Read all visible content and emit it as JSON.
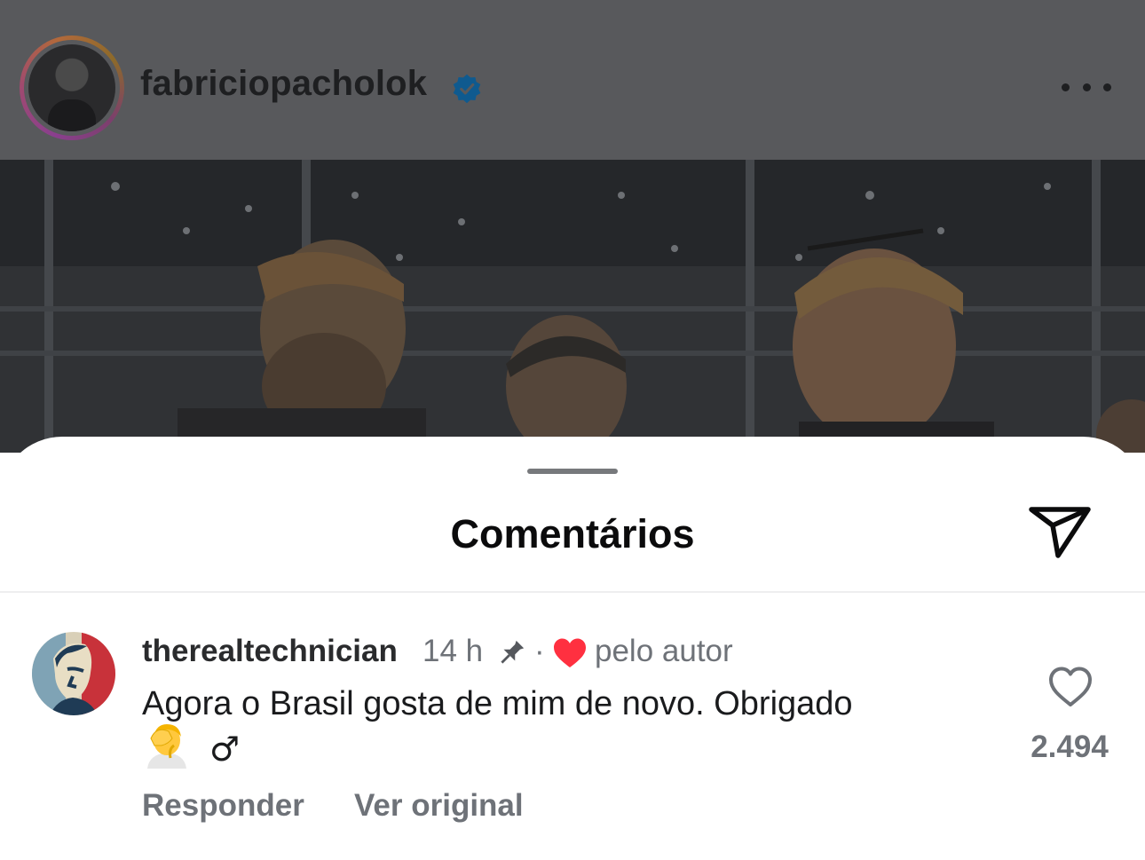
{
  "post": {
    "username": "fabriciopacholok",
    "verified_icon": "verified-badge-icon",
    "more_icon": "more-horizontal-icon"
  },
  "sheet": {
    "title": "Comentários",
    "share_icon": "paper-plane-icon"
  },
  "comment": {
    "username": "therealtechnician",
    "time": "14 h",
    "separator": "·",
    "by_author": "pelo autor",
    "text": "Agora o Brasil gosta de mim de novo. Obrigado",
    "male_sign": "♂",
    "reply": "Responder",
    "see_original": "Ver original",
    "likes": "2.494",
    "pin_icon": "pin-icon",
    "liked_icon": "heart-filled-icon",
    "like_icon": "heart-outline-icon",
    "emoji": "facepalm-emoji"
  },
  "colors": {
    "header_dim": "#58595c",
    "secondary_text": "#6e7278",
    "heart_red": "#ff3040",
    "verified_blue": "#0f5a8f"
  }
}
